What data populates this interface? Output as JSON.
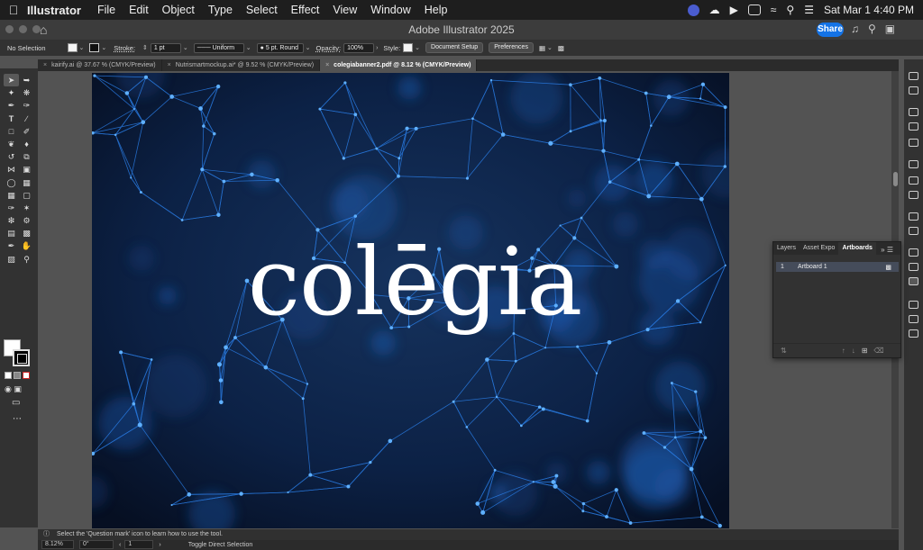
{
  "menubar": {
    "app_name": "Illustrator",
    "items": [
      "File",
      "Edit",
      "Object",
      "Type",
      "Select",
      "Effect",
      "View",
      "Window",
      "Help"
    ],
    "clock": "Sat Mar 1  4:40 PM"
  },
  "window": {
    "title": "Adobe Illustrator 2025",
    "share_label": "Share"
  },
  "control_bar": {
    "selection": "No Selection",
    "stroke_label": "Stroke:",
    "stroke_value": "1 pt",
    "profile": "Uniform",
    "brush": "5 pt. Round",
    "opacity_label": "Opacity:",
    "opacity_value": "100%",
    "style_label": "Style:",
    "document_setup": "Document Setup",
    "preferences": "Preferences"
  },
  "tabs": [
    {
      "label": "kairify.ai @ 37.67 % (CMYK/Preview)"
    },
    {
      "label": "Nutrismartmockup.ai* @ 9.52 % (CMYK/Preview)"
    },
    {
      "label": "colegiabanner2.pdf @ 8.12 % (CMYK/Preview)"
    }
  ],
  "artboard": {
    "brand_text": "colēgia"
  },
  "panel": {
    "tabs": [
      "Layers",
      "Asset Expo",
      "Artboards"
    ],
    "active_tab": "Artboards",
    "rows": [
      {
        "num": "1",
        "name": "Artboard 1"
      }
    ]
  },
  "hint": "Select the 'Question mark' icon to learn how to use the tool.",
  "status": {
    "zoom": "8.12%",
    "rotation": "0°",
    "artboard_num": "1",
    "tool": "Toggle Direct Selection"
  },
  "colors": {
    "share_blue": "#1473e6",
    "network_blue": "#2f8cff",
    "artboard_dark": "#0a1a33"
  }
}
